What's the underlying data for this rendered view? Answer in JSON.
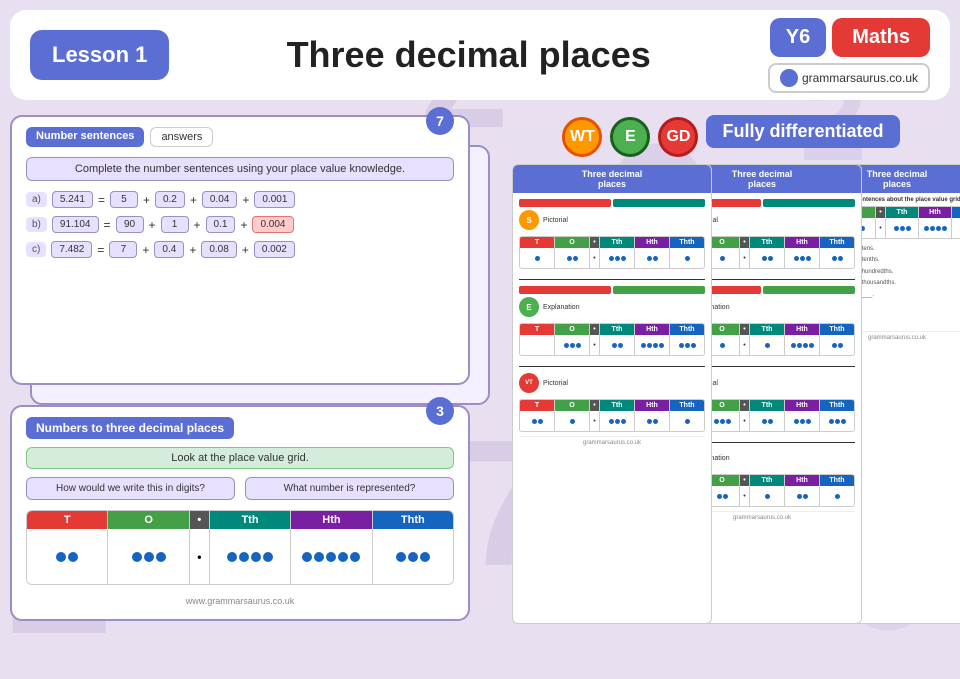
{
  "header": {
    "lesson_label": "Lesson 1",
    "title": "Three decimal places",
    "y6_label": "Y6",
    "maths_label": "Maths",
    "website": "grammarsaurus.co.uk"
  },
  "slide1": {
    "tab_label": "Number sentences",
    "answers_label": "answers",
    "slide_number": "7",
    "instruction": "Complete the number sentences using your place value knowledge.",
    "equations": [
      {
        "label": "a)",
        "left": "5.241",
        "parts": [
          "5",
          "+",
          "0.2",
          "+",
          "0.04",
          "+",
          "0.001"
        ]
      },
      {
        "label": "b)",
        "left": "91.104",
        "parts": [
          "90",
          "+",
          "1",
          "+",
          "0.1",
          "+",
          "0.004"
        ]
      },
      {
        "label": "c)",
        "left": "7.482",
        "parts": [
          "7",
          "+",
          "0.4",
          "+",
          "0.08",
          "+",
          "0.002"
        ]
      }
    ]
  },
  "slide2": {
    "title": "Numbers to three decimal places",
    "slide_number": "3",
    "instruction": "Look at the place value grid.",
    "question1": "How would we write this in digits?",
    "question2": "What number is represented?",
    "grid_headers": [
      "T",
      "O",
      "•",
      "Tth",
      "Hth",
      "Thth"
    ]
  },
  "differentiation": {
    "badges": [
      {
        "label": "WT",
        "color": "#ff9800"
      },
      {
        "label": "E",
        "color": "#4caf50"
      },
      {
        "label": "GD",
        "color": "#e53935"
      }
    ],
    "banner": "Fully differentiated"
  },
  "worksheets": [
    {
      "title": "Three decimal places",
      "sections": [
        {
          "type": "labeled",
          "label": "S",
          "color": "#ff9800"
        },
        {
          "type": "labeled",
          "label": "E",
          "color": "#4caf50"
        },
        {
          "type": "label",
          "text": "Pictorial"
        },
        {
          "type": "labeled",
          "label": "VT",
          "color": "#e53935"
        }
      ]
    },
    {
      "title": "Three decimal places",
      "sections": [
        {
          "type": "labeled",
          "label": "S",
          "color": "#ff9800"
        },
        {
          "type": "labeled",
          "label": "E",
          "color": "#4caf50"
        },
        {
          "type": "label",
          "text": "Pictorial"
        },
        {
          "type": "labeled",
          "label": "VT",
          "color": "#e53935"
        }
      ]
    },
    {
      "title": "Three decimal places",
      "sections": []
    }
  ],
  "bg_numbers": [
    "2",
    "6",
    "7",
    "3",
    "1",
    "2",
    "5",
    "8"
  ]
}
